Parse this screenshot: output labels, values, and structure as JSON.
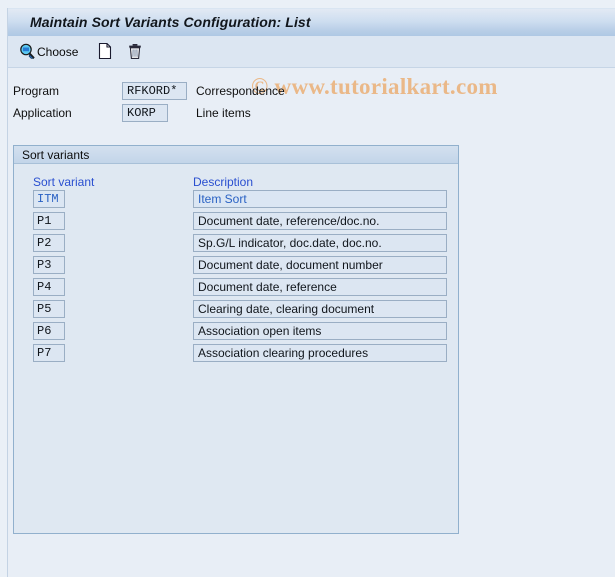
{
  "window": {
    "title": "Maintain Sort Variants Configuration: List"
  },
  "toolbar": {
    "choose_label": "Choose",
    "choose_icon": "magnifier-select-icon",
    "new_icon": "new-document-icon",
    "delete_icon": "trash-delete-icon"
  },
  "watermark": {
    "text": "© www.tutorialkart.com",
    "color": "#eab888"
  },
  "header_form": {
    "program": {
      "label": "Program",
      "value": "RFKORD*",
      "description": "Correspondence"
    },
    "application": {
      "label": "Application",
      "value": "KORP",
      "description": "Line items"
    }
  },
  "group": {
    "title": "Sort variants",
    "columns": {
      "variant": "Sort variant",
      "description": "Description"
    },
    "column_header_color": "#2a4fd0",
    "rows": [
      {
        "variant": "ITM",
        "description": "Item Sort",
        "selected": true
      },
      {
        "variant": "P1",
        "description": "Document date, reference/doc.no.",
        "selected": false
      },
      {
        "variant": "P2",
        "description": "Sp.G/L indicator, doc.date, doc.no.",
        "selected": false
      },
      {
        "variant": "P3",
        "description": "Document date, document number",
        "selected": false
      },
      {
        "variant": "P4",
        "description": "Document date, reference",
        "selected": false
      },
      {
        "variant": "P5",
        "description": "Clearing date, clearing document",
        "selected": false
      },
      {
        "variant": "P6",
        "description": "Association open items",
        "selected": false
      },
      {
        "variant": "P7",
        "description": "Association clearing procedures",
        "selected": false
      }
    ]
  },
  "colors": {
    "page_background": "#e8eef6",
    "title_bar": "#bbd0e8",
    "toolbar": "#dce6f2",
    "group_background": "#dfe8f2",
    "field_background": "#dce6f2",
    "field_border": "#9aaec4"
  }
}
